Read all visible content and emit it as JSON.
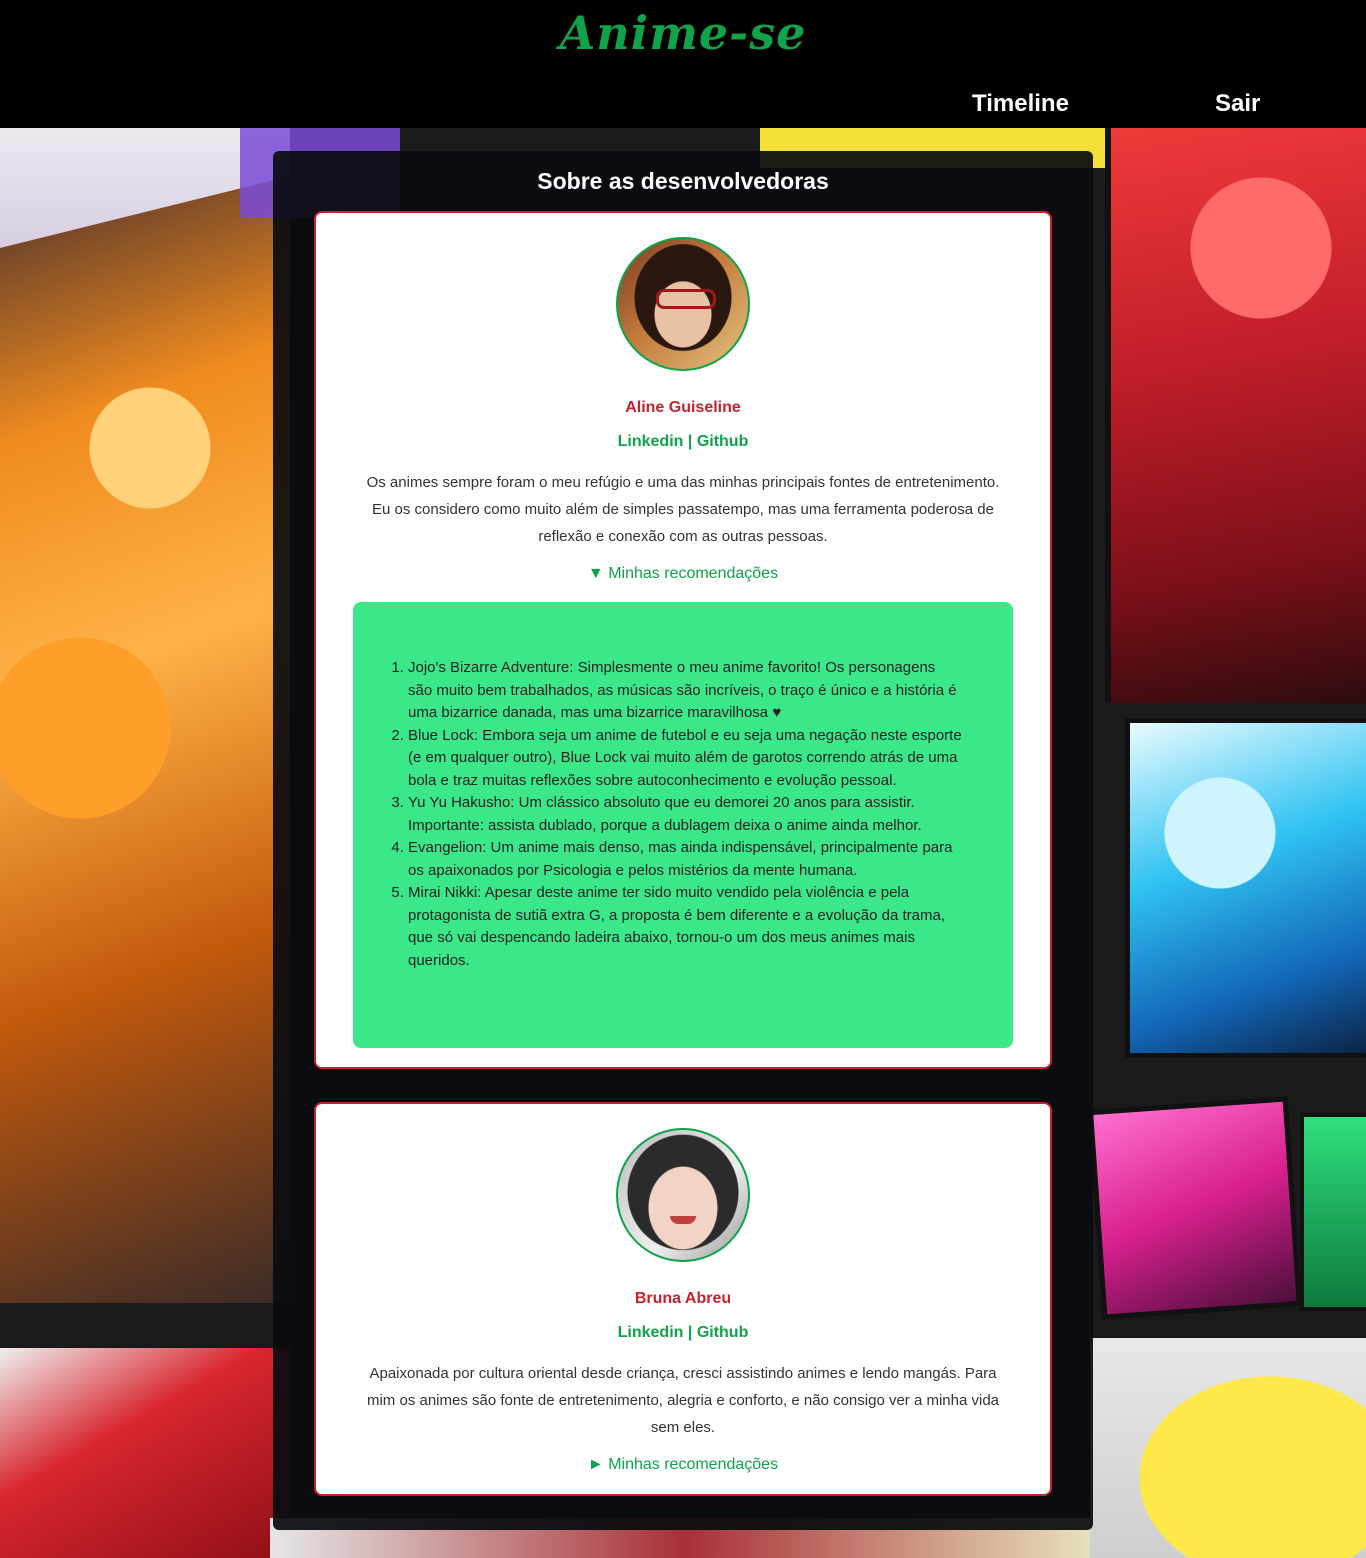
{
  "header": {
    "logo": "Anime-se",
    "nav": {
      "timeline": "Timeline",
      "sair": "Sair"
    }
  },
  "main": {
    "title": "Sobre as desenvolvedoras"
  },
  "developers": [
    {
      "name": "Aline Guiseline",
      "links": {
        "linkedin": "Linkedin",
        "separator": "|",
        "github": "Github"
      },
      "bio": "Os animes sempre foram o meu refúgio e uma das minhas principais fontes de entretenimento. Eu os considero como muito além de simples passatempo, mas uma ferramenta poderosa de reflexão e conexão com as outras pessoas.",
      "summary": "▼ Minhas recomendações",
      "expanded": true,
      "recommendations": [
        "Jojo's Bizarre Adventure: Simplesmente o meu anime favorito! Os personagens são muito bem trabalhados, as músicas são incríveis, o traço é único e a história é uma bizarrice danada, mas uma bizarrice maravilhosa ♥",
        "Blue Lock: Embora seja um anime de futebol e eu seja uma negação neste esporte (e em qualquer outro), Blue Lock vai muito além de garotos correndo atrás de uma bola e traz muitas reflexões sobre autoconhecimento e evolução pessoal.",
        "Yu Yu Hakusho: Um clássico absoluto que eu demorei 20 anos para assistir. Importante: assista dublado, porque a dublagem deixa o anime ainda melhor.",
        "Evangelion: Um anime mais denso, mas ainda indispensável, principalmente para os apaixonados por Psicologia e pelos mistérios da mente humana.",
        "Mirai Nikki: Apesar deste anime ter sido muito vendido pela violência e pela protagonista de sutiã extra G, a proposta é bem diferente e a evolução da trama, que só vai despencando ladeira abaixo, tornou-o um dos meus animes mais queridos."
      ]
    },
    {
      "name": "Bruna Abreu",
      "links": {
        "linkedin": "Linkedin",
        "separator": "|",
        "github": "Github"
      },
      "bio": "Apaixonada por cultura oriental desde criança, cresci assistindo animes e lendo mangás. Para mim os animes são fonte de entretenimento, alegria e conforto, e não consigo ver a minha vida sem eles.",
      "summary": "► Minhas recomendações",
      "expanded": false
    }
  ],
  "colors": {
    "brand_green": "#0fa34a",
    "accent_red": "#c9202e",
    "reco_bg": "#3ae88a",
    "header_bg": "#000000"
  }
}
